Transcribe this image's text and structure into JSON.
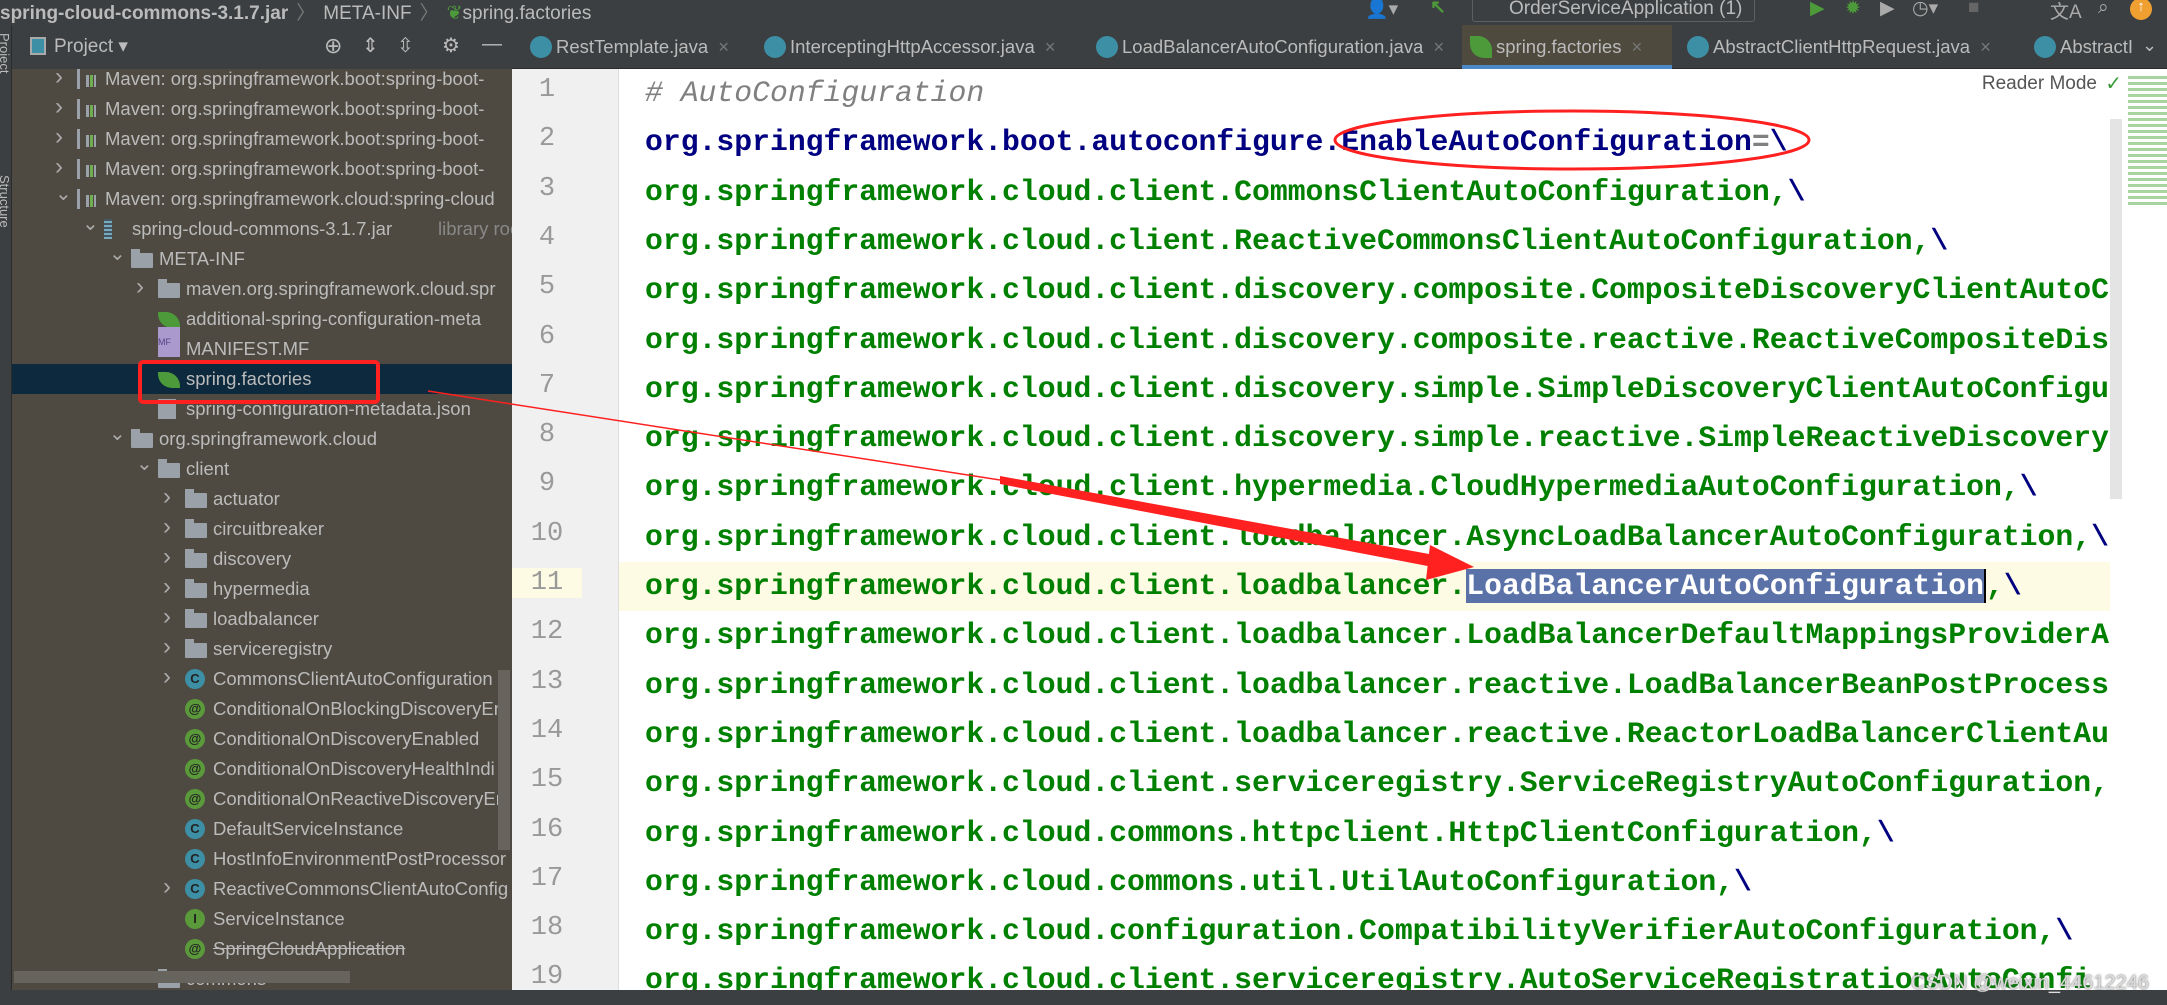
{
  "titlebar": {
    "breadcrumb": [
      "spring-cloud-commons-3.1.7.jar",
      "META-INF",
      "spring.factories"
    ],
    "run_config": "OrderServiceApplication (1)"
  },
  "left_strip": {
    "labels": [
      "Project",
      "Structure"
    ]
  },
  "project_panel": {
    "title": "Project",
    "tree": [
      {
        "level": 0,
        "chevron": "closed",
        "icon": "maven-library",
        "label": "Maven: org.springframework.boot:spring-boot-"
      },
      {
        "level": 0,
        "chevron": "closed",
        "icon": "maven-library",
        "label": "Maven: org.springframework.boot:spring-boot-"
      },
      {
        "level": 0,
        "chevron": "closed",
        "icon": "maven-library",
        "label": "Maven: org.springframework.boot:spring-boot-"
      },
      {
        "level": 0,
        "chevron": "closed",
        "icon": "maven-library",
        "label": "Maven: org.springframework.boot:spring-boot-"
      },
      {
        "level": 0,
        "chevron": "open",
        "icon": "maven-library",
        "label": "Maven: org.springframework.cloud:spring-cloud"
      },
      {
        "level": 1,
        "chevron": "open",
        "icon": "jar",
        "label": "spring-cloud-commons-3.1.7.jar",
        "suffix": "library root"
      },
      {
        "level": 2,
        "chevron": "open",
        "icon": "folder",
        "label": "META-INF"
      },
      {
        "level": 3,
        "chevron": "closed",
        "icon": "folder",
        "label": "maven.org.springframework.cloud.spr"
      },
      {
        "level": 3,
        "chevron": "none",
        "icon": "spring-config",
        "label": "additional-spring-configuration-meta"
      },
      {
        "level": 3,
        "chevron": "none",
        "icon": "manifest",
        "label": "MANIFEST.MF"
      },
      {
        "level": 3,
        "chevron": "none",
        "icon": "spring-leaf",
        "label": "spring.factories",
        "selected": true
      },
      {
        "level": 3,
        "chevron": "none",
        "icon": "json",
        "label": "spring-configuration-metadata.json"
      },
      {
        "level": 2,
        "chevron": "open",
        "icon": "folder",
        "label": "org.springframework.cloud"
      },
      {
        "level": 3,
        "chevron": "open",
        "icon": "folder",
        "label": "client"
      },
      {
        "level": 4,
        "chevron": "closed",
        "icon": "folder",
        "label": "actuator"
      },
      {
        "level": 4,
        "chevron": "closed",
        "icon": "folder",
        "label": "circuitbreaker"
      },
      {
        "level": 4,
        "chevron": "closed",
        "icon": "folder",
        "label": "discovery"
      },
      {
        "level": 4,
        "chevron": "closed",
        "icon": "folder",
        "label": "hypermedia"
      },
      {
        "level": 4,
        "chevron": "closed",
        "icon": "folder",
        "label": "loadbalancer"
      },
      {
        "level": 4,
        "chevron": "closed",
        "icon": "folder",
        "label": "serviceregistry"
      },
      {
        "level": 4,
        "chevron": "closed",
        "icon": "class",
        "label": "CommonsClientAutoConfiguration"
      },
      {
        "level": 4,
        "chevron": "none",
        "icon": "annotation",
        "label": "ConditionalOnBlockingDiscoveryEn"
      },
      {
        "level": 4,
        "chevron": "none",
        "icon": "annotation",
        "label": "ConditionalOnDiscoveryEnabled"
      },
      {
        "level": 4,
        "chevron": "none",
        "icon": "annotation",
        "label": "ConditionalOnDiscoveryHealthIndi"
      },
      {
        "level": 4,
        "chevron": "none",
        "icon": "annotation",
        "label": "ConditionalOnReactiveDiscoveryEn"
      },
      {
        "level": 4,
        "chevron": "none",
        "icon": "class",
        "label": "DefaultServiceInstance"
      },
      {
        "level": 4,
        "chevron": "none",
        "icon": "class",
        "label": "HostInfoEnvironmentPostProcessor"
      },
      {
        "level": 4,
        "chevron": "closed",
        "icon": "class",
        "label": "ReactiveCommonsClientAutoConfig"
      },
      {
        "level": 4,
        "chevron": "none",
        "icon": "interface",
        "label": "ServiceInstance"
      },
      {
        "level": 4,
        "chevron": "none",
        "icon": "annotation",
        "label": "SpringCloudApplication",
        "deprecated": true
      },
      {
        "level": 3,
        "chevron": "closed",
        "icon": "folder",
        "label": "commons"
      }
    ]
  },
  "tabs": [
    {
      "label": "RestTemplate.java",
      "icon": "class"
    },
    {
      "label": "InterceptingHttpAccessor.java",
      "icon": "class"
    },
    {
      "label": "LoadBalancerAutoConfiguration.java",
      "icon": "class"
    },
    {
      "label": "spring.factories",
      "icon": "spring-leaf",
      "active": true
    },
    {
      "label": "AbstractClientHttpRequest.java",
      "icon": "class"
    },
    {
      "label": "AbstractI",
      "icon": "class"
    }
  ],
  "editor": {
    "reader_mode": "Reader Mode",
    "current_line": 11,
    "lines": [
      [
        {
          "t": "# AutoConfiguration",
          "c": "cm"
        }
      ],
      [
        {
          "t": "org.springframework.boot.autoconfigure.EnableAutoConfiguration",
          "c": "key"
        },
        {
          "t": "=",
          "c": "eq"
        },
        {
          "t": "\\",
          "c": "bs"
        }
      ],
      [
        {
          "t": "org.springframework.cloud.client.CommonsClientAutoConfiguration,"
        },
        {
          "t": "\\",
          "c": "bs"
        }
      ],
      [
        {
          "t": "org.springframework.cloud.client.ReactiveCommonsClientAutoConfiguration,"
        },
        {
          "t": "\\",
          "c": "bs"
        }
      ],
      [
        {
          "t": "org.springframework.cloud.client.discovery.composite.CompositeDiscoveryClientAutoC"
        }
      ],
      [
        {
          "t": "org.springframework.cloud.client.discovery.composite.reactive.ReactiveCompositeDis"
        }
      ],
      [
        {
          "t": "org.springframework.cloud.client.discovery.simple.SimpleDiscoveryClientAutoConfigu"
        }
      ],
      [
        {
          "t": "org.springframework.cloud.client.discovery.simple.reactive.SimpleReactiveDiscovery"
        }
      ],
      [
        {
          "t": "org.springframework.cloud.client.hypermedia.CloudHypermediaAutoConfiguration,"
        },
        {
          "t": "\\",
          "c": "bs"
        }
      ],
      [
        {
          "t": "org.springframework.cloud.client.loadbalancer.AsyncLoadBalancerAutoConfiguration,"
        },
        {
          "t": "\\",
          "c": "bs"
        }
      ],
      [
        {
          "t": "org.springframework.cloud.client.loadbalancer."
        },
        {
          "t": "LoadBalancerAutoConfiguration",
          "c": "selt"
        },
        {
          "t": ","
        },
        {
          "t": "\\",
          "c": "bs"
        }
      ],
      [
        {
          "t": "org.springframework.cloud.client.loadbalancer.LoadBalancerDefaultMappingsProviderA"
        }
      ],
      [
        {
          "t": "org.springframework.cloud.client.loadbalancer.reactive.LoadBalancerBeanPostProcess"
        }
      ],
      [
        {
          "t": "org.springframework.cloud.client.loadbalancer.reactive.ReactorLoadBalancerClientAu"
        }
      ],
      [
        {
          "t": "org.springframework.cloud.client.serviceregistry.ServiceRegistryAutoConfiguration,"
        }
      ],
      [
        {
          "t": "org.springframework.cloud.commons.httpclient.HttpClientConfiguration,"
        },
        {
          "t": "\\",
          "c": "bs"
        }
      ],
      [
        {
          "t": "org.springframework.cloud.commons.util.UtilAutoConfiguration,"
        },
        {
          "t": "\\",
          "c": "bs"
        }
      ],
      [
        {
          "t": "org.springframework.cloud.configuration.CompatibilityVerifierAutoConfiguration,"
        },
        {
          "t": "\\",
          "c": "bs"
        }
      ],
      [
        {
          "t": "org.springframework.cloud.client.serviceregistry.AutoServiceRegistrationAutoConfi"
        }
      ]
    ]
  },
  "annotations": {
    "color": "#ff2020",
    "highlight_tree_item": "spring.factories",
    "highlight_code_key": "EnableAutoConfiguration"
  },
  "watermark": "CSDN @weixin_44612246",
  "colors": {
    "accent_tab": "#4a88c7",
    "code_green": "#008000",
    "code_key": "#000080",
    "selection": "#5a72a8"
  }
}
